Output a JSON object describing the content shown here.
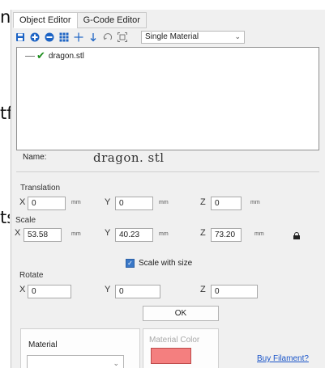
{
  "background_fragments": [
    "n",
    "tform",
    "ts"
  ],
  "tabs": [
    {
      "label": "Object Editor",
      "active": true
    },
    {
      "label": "G-Code Editor",
      "active": false
    }
  ],
  "toolbar": {
    "icons": [
      "save-icon",
      "add-icon",
      "remove-icon",
      "grid-icon",
      "move-icon",
      "down-arrow-icon",
      "rotate-icon",
      "scale-icon"
    ],
    "material_mode": "Single Material"
  },
  "object_tree": {
    "items": [
      {
        "name": "dragon.stl",
        "status_icon": "checkmark-icon"
      }
    ]
  },
  "name": {
    "label": "Name:",
    "value": "dragon. stl"
  },
  "translation": {
    "title": "Translation",
    "x": "0",
    "y": "0",
    "z": "0",
    "unit": "mm"
  },
  "scale": {
    "title": "Scale",
    "x": "53.58",
    "y": "40.23",
    "z": "73.20",
    "unit": "mm",
    "locked": true,
    "scale_with_size_label": "Scale with size",
    "scale_with_size_checked": true
  },
  "rotate": {
    "title": "Rotate",
    "x": "0",
    "y": "0",
    "z": "0"
  },
  "axis_labels": {
    "x": "X",
    "y": "Y",
    "z": "Z"
  },
  "ok_label": "OK",
  "material": {
    "label": "Material",
    "value": ""
  },
  "material_color": {
    "label": "Material Color",
    "color": "#f47f7f"
  },
  "buy_filament_label": "Buy Filament?",
  "colors": {
    "accent": "#1c63c4",
    "link": "#1a55c9",
    "check_green": "#1d8d1d"
  }
}
